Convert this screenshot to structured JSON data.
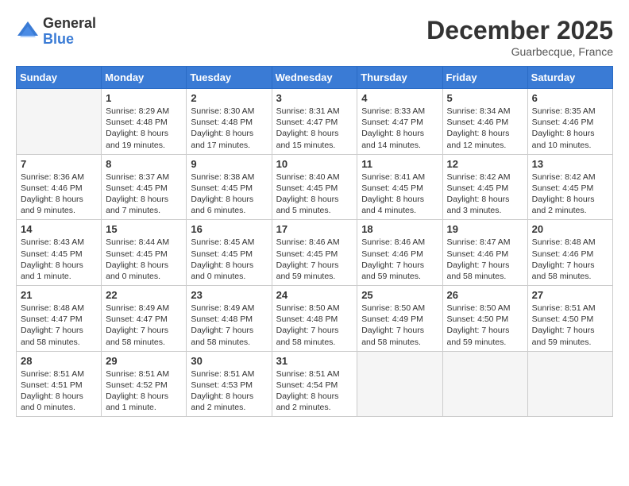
{
  "logo": {
    "general": "General",
    "blue": "Blue"
  },
  "title": "December 2025",
  "location": "Guarbecque, France",
  "days_of_week": [
    "Sunday",
    "Monday",
    "Tuesday",
    "Wednesday",
    "Thursday",
    "Friday",
    "Saturday"
  ],
  "weeks": [
    [
      {
        "day": "",
        "sunrise": "",
        "sunset": "",
        "daylight": ""
      },
      {
        "day": "1",
        "sunrise": "Sunrise: 8:29 AM",
        "sunset": "Sunset: 4:48 PM",
        "daylight": "Daylight: 8 hours and 19 minutes."
      },
      {
        "day": "2",
        "sunrise": "Sunrise: 8:30 AM",
        "sunset": "Sunset: 4:48 PM",
        "daylight": "Daylight: 8 hours and 17 minutes."
      },
      {
        "day": "3",
        "sunrise": "Sunrise: 8:31 AM",
        "sunset": "Sunset: 4:47 PM",
        "daylight": "Daylight: 8 hours and 15 minutes."
      },
      {
        "day": "4",
        "sunrise": "Sunrise: 8:33 AM",
        "sunset": "Sunset: 4:47 PM",
        "daylight": "Daylight: 8 hours and 14 minutes."
      },
      {
        "day": "5",
        "sunrise": "Sunrise: 8:34 AM",
        "sunset": "Sunset: 4:46 PM",
        "daylight": "Daylight: 8 hours and 12 minutes."
      },
      {
        "day": "6",
        "sunrise": "Sunrise: 8:35 AM",
        "sunset": "Sunset: 4:46 PM",
        "daylight": "Daylight: 8 hours and 10 minutes."
      }
    ],
    [
      {
        "day": "7",
        "sunrise": "Sunrise: 8:36 AM",
        "sunset": "Sunset: 4:46 PM",
        "daylight": "Daylight: 8 hours and 9 minutes."
      },
      {
        "day": "8",
        "sunrise": "Sunrise: 8:37 AM",
        "sunset": "Sunset: 4:45 PM",
        "daylight": "Daylight: 8 hours and 7 minutes."
      },
      {
        "day": "9",
        "sunrise": "Sunrise: 8:38 AM",
        "sunset": "Sunset: 4:45 PM",
        "daylight": "Daylight: 8 hours and 6 minutes."
      },
      {
        "day": "10",
        "sunrise": "Sunrise: 8:40 AM",
        "sunset": "Sunset: 4:45 PM",
        "daylight": "Daylight: 8 hours and 5 minutes."
      },
      {
        "day": "11",
        "sunrise": "Sunrise: 8:41 AM",
        "sunset": "Sunset: 4:45 PM",
        "daylight": "Daylight: 8 hours and 4 minutes."
      },
      {
        "day": "12",
        "sunrise": "Sunrise: 8:42 AM",
        "sunset": "Sunset: 4:45 PM",
        "daylight": "Daylight: 8 hours and 3 minutes."
      },
      {
        "day": "13",
        "sunrise": "Sunrise: 8:42 AM",
        "sunset": "Sunset: 4:45 PM",
        "daylight": "Daylight: 8 hours and 2 minutes."
      }
    ],
    [
      {
        "day": "14",
        "sunrise": "Sunrise: 8:43 AM",
        "sunset": "Sunset: 4:45 PM",
        "daylight": "Daylight: 8 hours and 1 minute."
      },
      {
        "day": "15",
        "sunrise": "Sunrise: 8:44 AM",
        "sunset": "Sunset: 4:45 PM",
        "daylight": "Daylight: 8 hours and 0 minutes."
      },
      {
        "day": "16",
        "sunrise": "Sunrise: 8:45 AM",
        "sunset": "Sunset: 4:45 PM",
        "daylight": "Daylight: 8 hours and 0 minutes."
      },
      {
        "day": "17",
        "sunrise": "Sunrise: 8:46 AM",
        "sunset": "Sunset: 4:45 PM",
        "daylight": "Daylight: 7 hours and 59 minutes."
      },
      {
        "day": "18",
        "sunrise": "Sunrise: 8:46 AM",
        "sunset": "Sunset: 4:46 PM",
        "daylight": "Daylight: 7 hours and 59 minutes."
      },
      {
        "day": "19",
        "sunrise": "Sunrise: 8:47 AM",
        "sunset": "Sunset: 4:46 PM",
        "daylight": "Daylight: 7 hours and 58 minutes."
      },
      {
        "day": "20",
        "sunrise": "Sunrise: 8:48 AM",
        "sunset": "Sunset: 4:46 PM",
        "daylight": "Daylight: 7 hours and 58 minutes."
      }
    ],
    [
      {
        "day": "21",
        "sunrise": "Sunrise: 8:48 AM",
        "sunset": "Sunset: 4:47 PM",
        "daylight": "Daylight: 7 hours and 58 minutes."
      },
      {
        "day": "22",
        "sunrise": "Sunrise: 8:49 AM",
        "sunset": "Sunset: 4:47 PM",
        "daylight": "Daylight: 7 hours and 58 minutes."
      },
      {
        "day": "23",
        "sunrise": "Sunrise: 8:49 AM",
        "sunset": "Sunset: 4:48 PM",
        "daylight": "Daylight: 7 hours and 58 minutes."
      },
      {
        "day": "24",
        "sunrise": "Sunrise: 8:50 AM",
        "sunset": "Sunset: 4:48 PM",
        "daylight": "Daylight: 7 hours and 58 minutes."
      },
      {
        "day": "25",
        "sunrise": "Sunrise: 8:50 AM",
        "sunset": "Sunset: 4:49 PM",
        "daylight": "Daylight: 7 hours and 58 minutes."
      },
      {
        "day": "26",
        "sunrise": "Sunrise: 8:50 AM",
        "sunset": "Sunset: 4:50 PM",
        "daylight": "Daylight: 7 hours and 59 minutes."
      },
      {
        "day": "27",
        "sunrise": "Sunrise: 8:51 AM",
        "sunset": "Sunset: 4:50 PM",
        "daylight": "Daylight: 7 hours and 59 minutes."
      }
    ],
    [
      {
        "day": "28",
        "sunrise": "Sunrise: 8:51 AM",
        "sunset": "Sunset: 4:51 PM",
        "daylight": "Daylight: 8 hours and 0 minutes."
      },
      {
        "day": "29",
        "sunrise": "Sunrise: 8:51 AM",
        "sunset": "Sunset: 4:52 PM",
        "daylight": "Daylight: 8 hours and 1 minute."
      },
      {
        "day": "30",
        "sunrise": "Sunrise: 8:51 AM",
        "sunset": "Sunset: 4:53 PM",
        "daylight": "Daylight: 8 hours and 2 minutes."
      },
      {
        "day": "31",
        "sunrise": "Sunrise: 8:51 AM",
        "sunset": "Sunset: 4:54 PM",
        "daylight": "Daylight: 8 hours and 2 minutes."
      },
      {
        "day": "",
        "sunrise": "",
        "sunset": "",
        "daylight": ""
      },
      {
        "day": "",
        "sunrise": "",
        "sunset": "",
        "daylight": ""
      },
      {
        "day": "",
        "sunrise": "",
        "sunset": "",
        "daylight": ""
      }
    ]
  ]
}
